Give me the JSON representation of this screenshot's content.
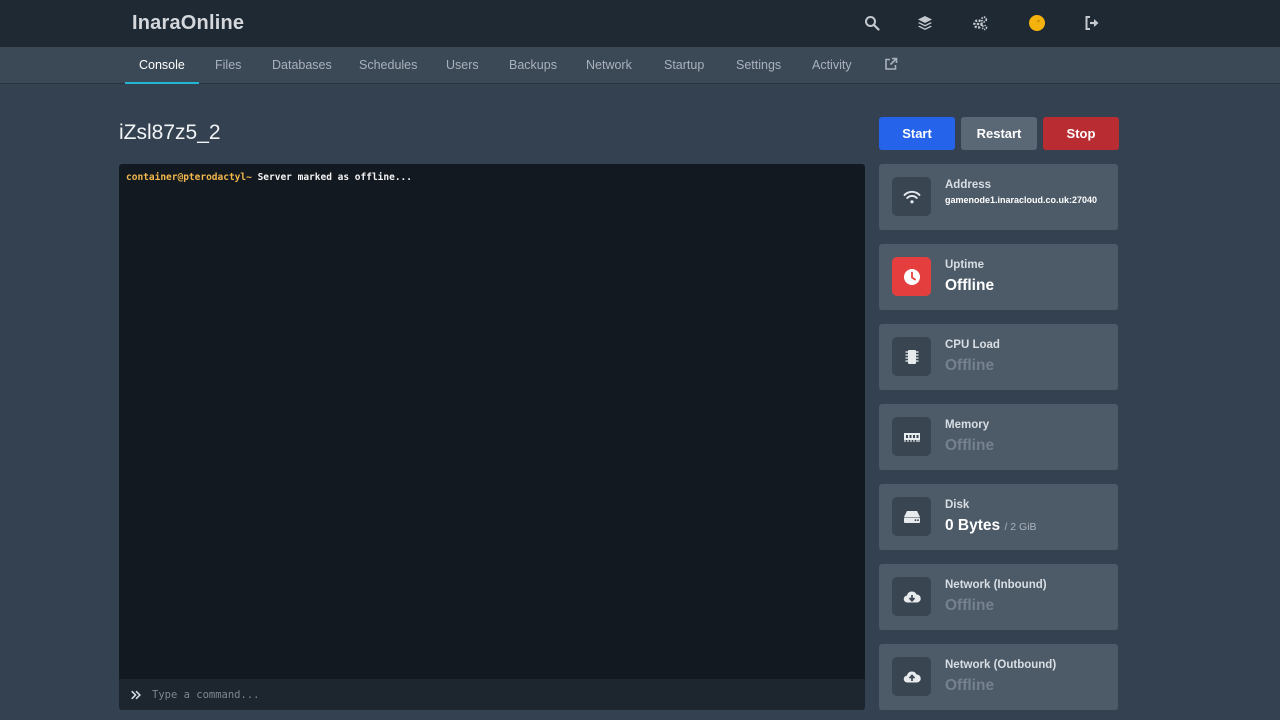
{
  "app": {
    "brand": "InaraOnline"
  },
  "topbar": {
    "icons": [
      "search-icon",
      "layers-icon",
      "cogs-icon",
      "avatar-icon",
      "logout-icon"
    ],
    "avatar_color": "#f5b20c"
  },
  "tabs": [
    {
      "label": "Console",
      "active": true
    },
    {
      "label": "Files"
    },
    {
      "label": "Databases"
    },
    {
      "label": "Schedules"
    },
    {
      "label": "Users"
    },
    {
      "label": "Backups"
    },
    {
      "label": "Network"
    },
    {
      "label": "Startup"
    },
    {
      "label": "Settings"
    },
    {
      "label": "Activity"
    }
  ],
  "server": {
    "name": "iZsl87z5_2"
  },
  "power": {
    "start": "Start",
    "restart": "Restart",
    "stop": "Stop"
  },
  "console": {
    "prompt": "container@pterodactyl~",
    "message": " Server marked as offline...",
    "placeholder": "Type a command..."
  },
  "stats": {
    "address": {
      "label": "Address",
      "value": "gamenode1.inaracloud.co.uk:27040"
    },
    "uptime": {
      "label": "Uptime",
      "value": "Offline"
    },
    "cpu": {
      "label": "CPU Load",
      "value": "Offline"
    },
    "memory": {
      "label": "Memory",
      "value": "Offline"
    },
    "disk": {
      "label": "Disk",
      "value": "0 Bytes",
      "limit": "/ 2 GiB"
    },
    "net_in": {
      "label": "Network (Inbound)",
      "value": "Offline"
    },
    "net_out": {
      "label": "Network (Outbound)",
      "value": "Offline"
    }
  },
  "colors": {
    "accent": "#22b5d4",
    "start": "#2563eb",
    "restart": "#5a6775",
    "stop": "#b92c32",
    "danger": "#e53e3e"
  }
}
